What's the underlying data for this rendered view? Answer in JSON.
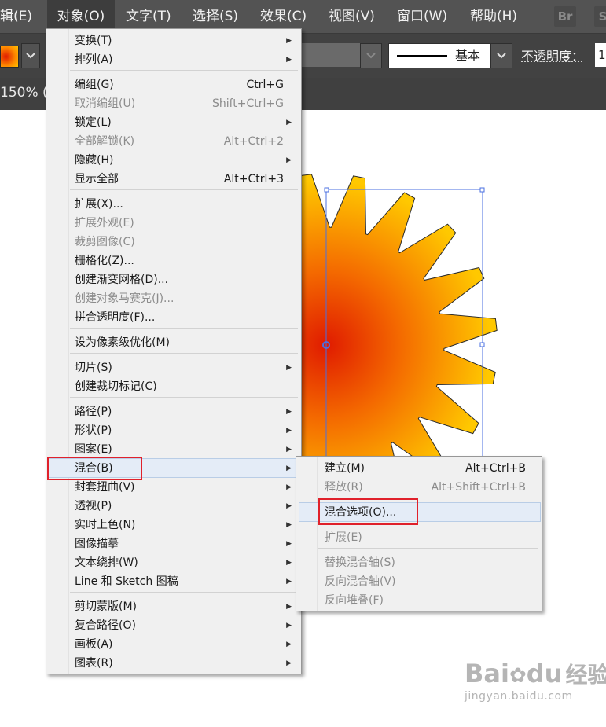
{
  "menubar": {
    "items": [
      "辑(E)",
      "对象(O)",
      "文字(T)",
      "选择(S)",
      "效果(C)",
      "视图(V)",
      "窗口(W)",
      "帮助(H)"
    ],
    "br": "Br",
    "st": "S"
  },
  "toolbar": {
    "stroke_style": "基本",
    "opacity_label": "不透明度：",
    "opacity_value": "1",
    "dropdown_icon": "chevron-down-icon"
  },
  "document": {
    "zoom": "150% ("
  },
  "object_menu": {
    "items": [
      {
        "label": "变换(T)",
        "shortcut": "",
        "submenu": true,
        "enabled": true
      },
      {
        "label": "排列(A)",
        "shortcut": "",
        "submenu": true,
        "enabled": true
      },
      {
        "label": "编组(G)",
        "shortcut": "Ctrl+G",
        "submenu": false,
        "enabled": true
      },
      {
        "label": "取消编组(U)",
        "shortcut": "Shift+Ctrl+G",
        "submenu": false,
        "enabled": false
      },
      {
        "label": "锁定(L)",
        "shortcut": "",
        "submenu": true,
        "enabled": true
      },
      {
        "label": "全部解锁(K)",
        "shortcut": "Alt+Ctrl+2",
        "submenu": false,
        "enabled": false
      },
      {
        "label": "隐藏(H)",
        "shortcut": "",
        "submenu": true,
        "enabled": true
      },
      {
        "label": "显示全部",
        "shortcut": "Alt+Ctrl+3",
        "submenu": false,
        "enabled": true
      },
      {
        "label": "扩展(X)...",
        "shortcut": "",
        "submenu": false,
        "enabled": true
      },
      {
        "label": "扩展外观(E)",
        "shortcut": "",
        "submenu": false,
        "enabled": false
      },
      {
        "label": "裁剪图像(C)",
        "shortcut": "",
        "submenu": false,
        "enabled": false
      },
      {
        "label": "栅格化(Z)...",
        "shortcut": "",
        "submenu": false,
        "enabled": true
      },
      {
        "label": "创建渐变网格(D)...",
        "shortcut": "",
        "submenu": false,
        "enabled": true
      },
      {
        "label": "创建对象马赛克(J)...",
        "shortcut": "",
        "submenu": false,
        "enabled": false
      },
      {
        "label": "拼合透明度(F)...",
        "shortcut": "",
        "submenu": false,
        "enabled": true
      },
      {
        "label": "设为像素级优化(M)",
        "shortcut": "",
        "submenu": false,
        "enabled": true
      },
      {
        "label": "切片(S)",
        "shortcut": "",
        "submenu": true,
        "enabled": true
      },
      {
        "label": "创建裁切标记(C)",
        "shortcut": "",
        "submenu": false,
        "enabled": true
      },
      {
        "label": "路径(P)",
        "shortcut": "",
        "submenu": true,
        "enabled": true
      },
      {
        "label": "形状(P)",
        "shortcut": "",
        "submenu": true,
        "enabled": true
      },
      {
        "label": "图案(E)",
        "shortcut": "",
        "submenu": true,
        "enabled": true
      },
      {
        "label": "混合(B)",
        "shortcut": "",
        "submenu": true,
        "enabled": true
      },
      {
        "label": "封套扭曲(V)",
        "shortcut": "",
        "submenu": true,
        "enabled": true
      },
      {
        "label": "透视(P)",
        "shortcut": "",
        "submenu": true,
        "enabled": true
      },
      {
        "label": "实时上色(N)",
        "shortcut": "",
        "submenu": true,
        "enabled": true
      },
      {
        "label": "图像描摹",
        "shortcut": "",
        "submenu": true,
        "enabled": true
      },
      {
        "label": "文本绕排(W)",
        "shortcut": "",
        "submenu": true,
        "enabled": true
      },
      {
        "label": "Line 和 Sketch 图稿",
        "shortcut": "",
        "submenu": true,
        "enabled": true
      },
      {
        "label": "剪切蒙版(M)",
        "shortcut": "",
        "submenu": true,
        "enabled": true
      },
      {
        "label": "复合路径(O)",
        "shortcut": "",
        "submenu": true,
        "enabled": true
      },
      {
        "label": "画板(A)",
        "shortcut": "",
        "submenu": true,
        "enabled": true
      },
      {
        "label": "图表(R)",
        "shortcut": "",
        "submenu": true,
        "enabled": true
      }
    ]
  },
  "blend_menu": {
    "items": [
      {
        "label": "建立(M)",
        "shortcut": "Alt+Ctrl+B",
        "enabled": true
      },
      {
        "label": "释放(R)",
        "shortcut": "Alt+Shift+Ctrl+B",
        "enabled": false
      },
      {
        "label": "混合选项(O)...",
        "shortcut": "",
        "enabled": true
      },
      {
        "label": "扩展(E)",
        "shortcut": "",
        "enabled": false
      },
      {
        "label": "替换混合轴(S)",
        "shortcut": "",
        "enabled": false
      },
      {
        "label": "反向混合轴(V)",
        "shortcut": "",
        "enabled": false
      },
      {
        "label": "反向堆叠(F)",
        "shortcut": "",
        "enabled": false
      }
    ]
  },
  "watermark": {
    "line1": "Bai",
    "line1b": "du",
    "line1c": "经验",
    "line2": "jingyan.baidu.com"
  },
  "colors": {
    "menubar": "#535353",
    "menu_bg": "#f0f0f0",
    "highlight": "#e4ecf7",
    "callout_red": "#e0212b",
    "gradient_inner": "#e01b00",
    "gradient_outer": "#ffc400",
    "selection_blue": "#4a6fe0"
  }
}
